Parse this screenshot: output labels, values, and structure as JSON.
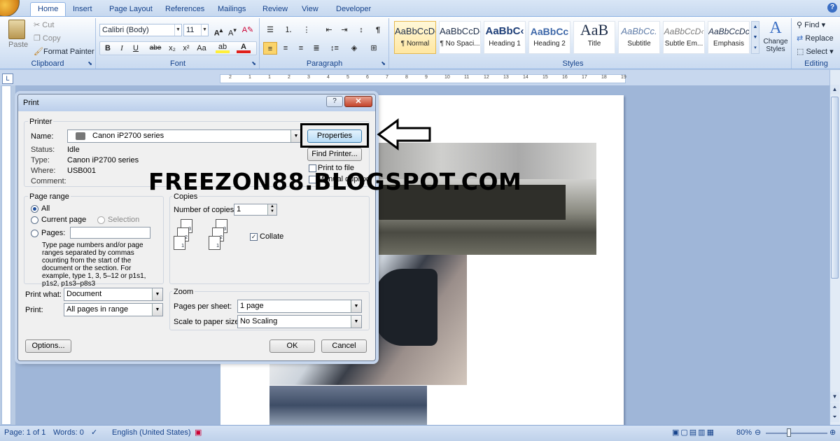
{
  "tabs": [
    "Home",
    "Insert",
    "Page Layout",
    "References",
    "Mailings",
    "Review",
    "View",
    "Developer"
  ],
  "clipboard": {
    "paste": "Paste",
    "cut": "Cut",
    "copy": "Copy",
    "format_painter": "Format Painter",
    "label": "Clipboard"
  },
  "font": {
    "family": "Calibri (Body)",
    "size": "11",
    "label": "Font",
    "buttons": [
      "B",
      "I",
      "U",
      "abe",
      "x₂",
      "x²",
      "Aa"
    ]
  },
  "paragraph": {
    "label": "Paragraph"
  },
  "styles": {
    "label": "Styles",
    "items": [
      {
        "preview": "AaBbCcDc",
        "name": "¶ Normal"
      },
      {
        "preview": "AaBbCcDc",
        "name": "¶ No Spaci..."
      },
      {
        "preview": "AaBbC‹",
        "name": "Heading 1"
      },
      {
        "preview": "AaBbCc",
        "name": "Heading 2"
      },
      {
        "preview": "AaB",
        "name": "Title"
      },
      {
        "preview": "AaBbCc.",
        "name": "Subtitle"
      },
      {
        "preview": "AaBbCcD‹",
        "name": "Subtle Em..."
      },
      {
        "preview": "AaBbCcDc",
        "name": "Emphasis"
      }
    ],
    "change": "Change Styles"
  },
  "editing": {
    "label": "Editing",
    "find": "Find",
    "replace": "Replace",
    "select": "Select"
  },
  "ruler_marks": [
    "2",
    "1",
    "1",
    "2",
    "3",
    "4",
    "5",
    "6",
    "7",
    "8",
    "9",
    "10",
    "11",
    "12",
    "13",
    "14",
    "15",
    "16",
    "17",
    "18",
    "19"
  ],
  "dialog": {
    "title": "Print",
    "printer": {
      "section": "Printer",
      "name_label": "Name:",
      "name_value": "Canon iP2700 series",
      "status_label": "Status:",
      "status_value": "Idle",
      "type_label": "Type:",
      "type_value": "Canon iP2700 series",
      "where_label": "Where:",
      "where_value": "USB001",
      "comment_label": "Comment:",
      "properties": "Properties",
      "find_printer": "Find Printer...",
      "print_to_file": "Print to file",
      "manual_duplex": "Manual duplex"
    },
    "page_range": {
      "section": "Page range",
      "all": "All",
      "current": "Current page",
      "selection": "Selection",
      "pages": "Pages:",
      "help": "Type page numbers and/or page ranges separated by commas counting from the start of the document or the section. For example, type 1, 3, 5–12 or p1s1, p1s2, p1s3–p8s3"
    },
    "copies": {
      "section": "Copies",
      "number_label": "Number of copies:",
      "number_value": "1",
      "collate": "Collate"
    },
    "print_what_label": "Print what:",
    "print_what_value": "Document",
    "print_label": "Print:",
    "print_value": "All pages in range",
    "zoom": {
      "section": "Zoom",
      "pps_label": "Pages per sheet:",
      "pps_value": "1 page",
      "scale_label": "Scale to paper size:",
      "scale_value": "No Scaling"
    },
    "options": "Options...",
    "ok": "OK",
    "cancel": "Cancel"
  },
  "watermark": "FREEZON88.BLOGSPOT.COM",
  "status": {
    "page": "Page: 1 of 1",
    "words": "Words: 0",
    "language": "English (United States)",
    "zoom": "80%"
  }
}
